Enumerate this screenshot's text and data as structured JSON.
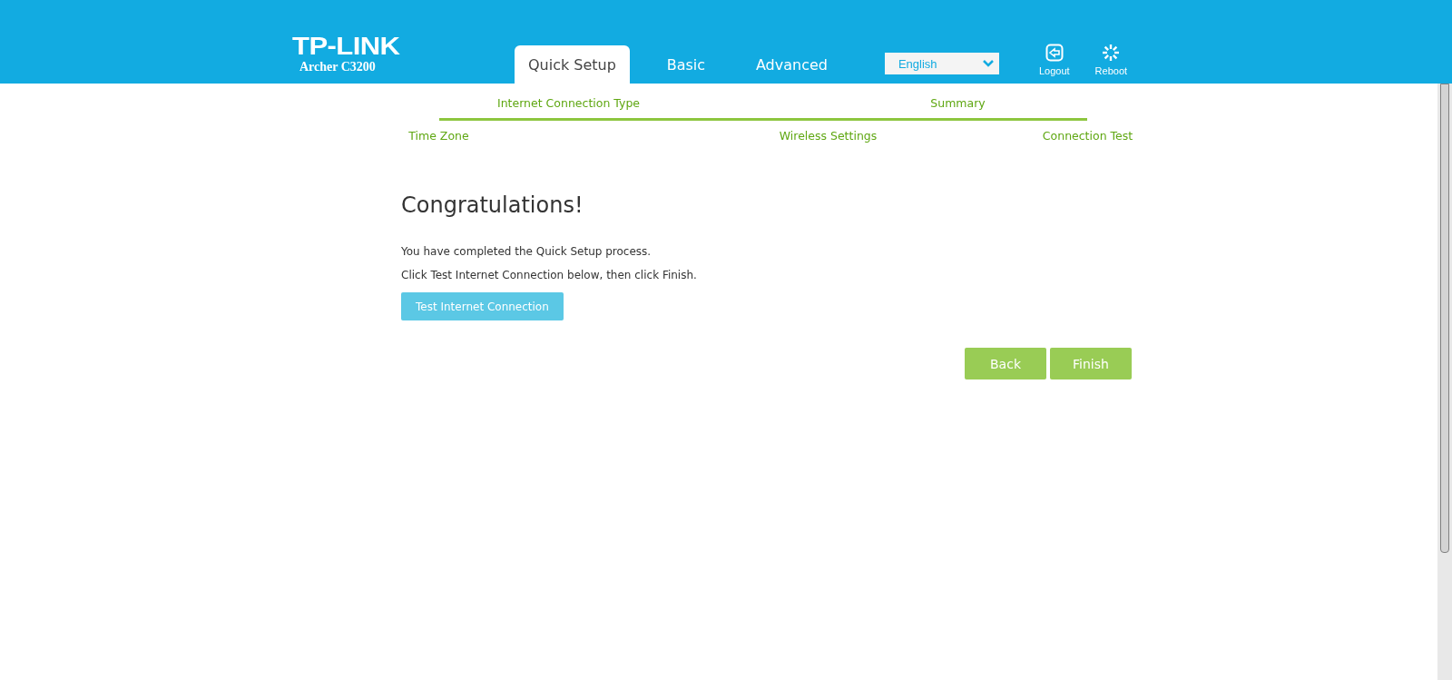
{
  "header": {
    "logo": "TP-LINK",
    "model": "Archer C3200",
    "tabs": [
      {
        "label": "Quick Setup",
        "selected": true
      },
      {
        "label": "Basic",
        "selected": false
      },
      {
        "label": "Advanced",
        "selected": false
      }
    ],
    "language": "English",
    "actions": [
      {
        "kind": "logout",
        "label": "Logout"
      },
      {
        "kind": "reboot",
        "label": "Reboot"
      }
    ]
  },
  "steps": [
    {
      "label": "Time Zone"
    },
    {
      "label": "Internet Connection Type"
    },
    {
      "label": "Wireless Settings"
    },
    {
      "label": "Summary"
    },
    {
      "label": "Connection Test"
    }
  ],
  "content": {
    "title": "Congratulations!",
    "lines": [
      "You have completed the Quick Setup process.",
      "Click Test Internet Connection below, then click Finish."
    ],
    "test_button": "Test Internet Connection"
  },
  "buttons": [
    "Back",
    "Finish"
  ]
}
